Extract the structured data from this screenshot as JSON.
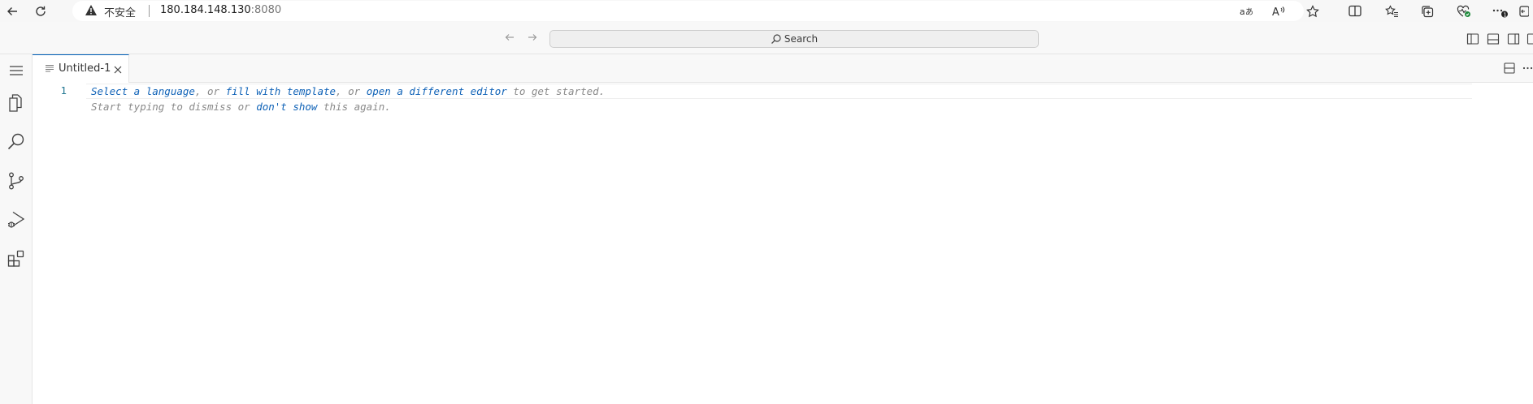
{
  "browser": {
    "security_label": "不安全",
    "url_host": "180.184.148.130",
    "url_port": ":8080",
    "toolbar_icons": [
      "back-icon",
      "reload-icon",
      "read-aloud-language-icon",
      "read-aloud-icon",
      "favorite-star-icon",
      "split-screen-icon",
      "favorites-icon",
      "collections-icon",
      "browser-essentials-icon",
      "more-icon",
      "extensions-icon"
    ],
    "notification_badge": "1"
  },
  "vscode": {
    "command_center": {
      "search_label": "Search",
      "nav_icons": [
        "back-arrow-icon",
        "forward-arrow-icon"
      ]
    },
    "layout_icons": [
      "toggle-primary-sidebar-icon",
      "toggle-panel-icon",
      "toggle-secondary-sidebar-icon"
    ],
    "activity_bar": [
      "menu-icon",
      "explorer-icon",
      "search-icon",
      "source-control-icon",
      "run-and-debug-icon",
      "extensions-icon"
    ],
    "tab": {
      "label": "Untitled-1"
    },
    "editor": {
      "line_number": "1",
      "hint": {
        "select_language": "Select a language",
        "sep1": ", or ",
        "fill_template": "fill with template",
        "sep2": ", or ",
        "open_editor": "open a different editor",
        "tail1": " to get started.",
        "start_typing": "Start typing to dismiss or ",
        "dont_show": "don't show",
        "tail2": " this again."
      }
    }
  }
}
